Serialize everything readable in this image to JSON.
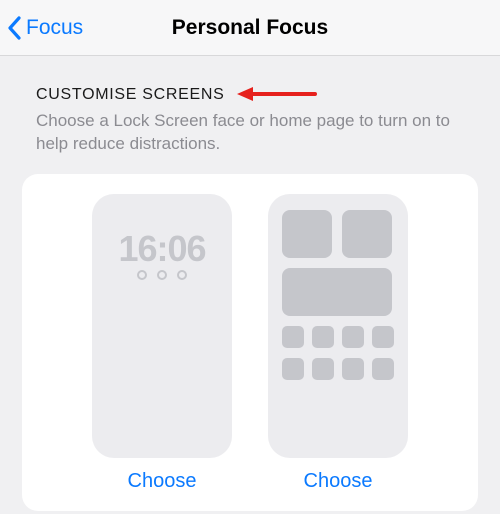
{
  "nav": {
    "back_label": "Focus",
    "title": "Personal Focus"
  },
  "section": {
    "header": "CUSTOMISE SCREENS",
    "subtext": "Choose a Lock Screen face or home page to turn on to help reduce distractions."
  },
  "lockscreen": {
    "time": "16:06",
    "choose_label": "Choose"
  },
  "homescreen": {
    "choose_label": "Choose"
  },
  "colors": {
    "accent": "#0b7aff",
    "placeholder": "#c5c6cb"
  }
}
